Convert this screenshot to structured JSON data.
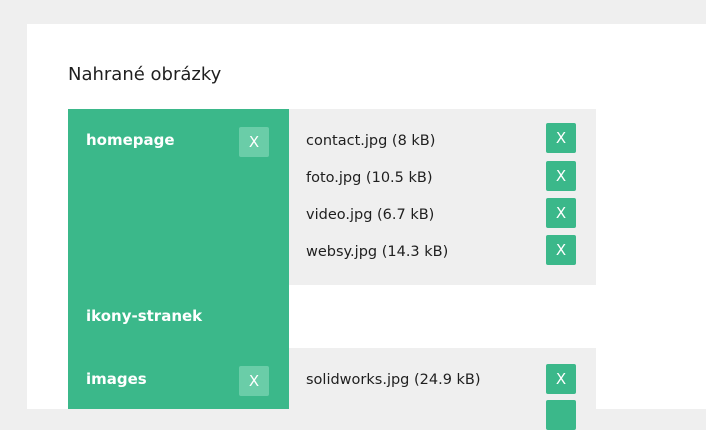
{
  "title": "Nahrané obrázky",
  "close_label": "X",
  "folders": [
    {
      "name": "homepage",
      "files": [
        "contact.jpg (8 kB)",
        "foto.jpg (10.5 kB)",
        "video.jpg (6.7 kB)",
        "websy.jpg (14.3 kB)"
      ]
    },
    {
      "name": "ikony-stranek",
      "files": []
    },
    {
      "name": "images",
      "files": [
        "solidworks.jpg (24.9 kB)"
      ]
    }
  ],
  "colors": {
    "accent": "#3bb88a",
    "accent_light": "#6acda8",
    "files_background": "#efefef"
  }
}
